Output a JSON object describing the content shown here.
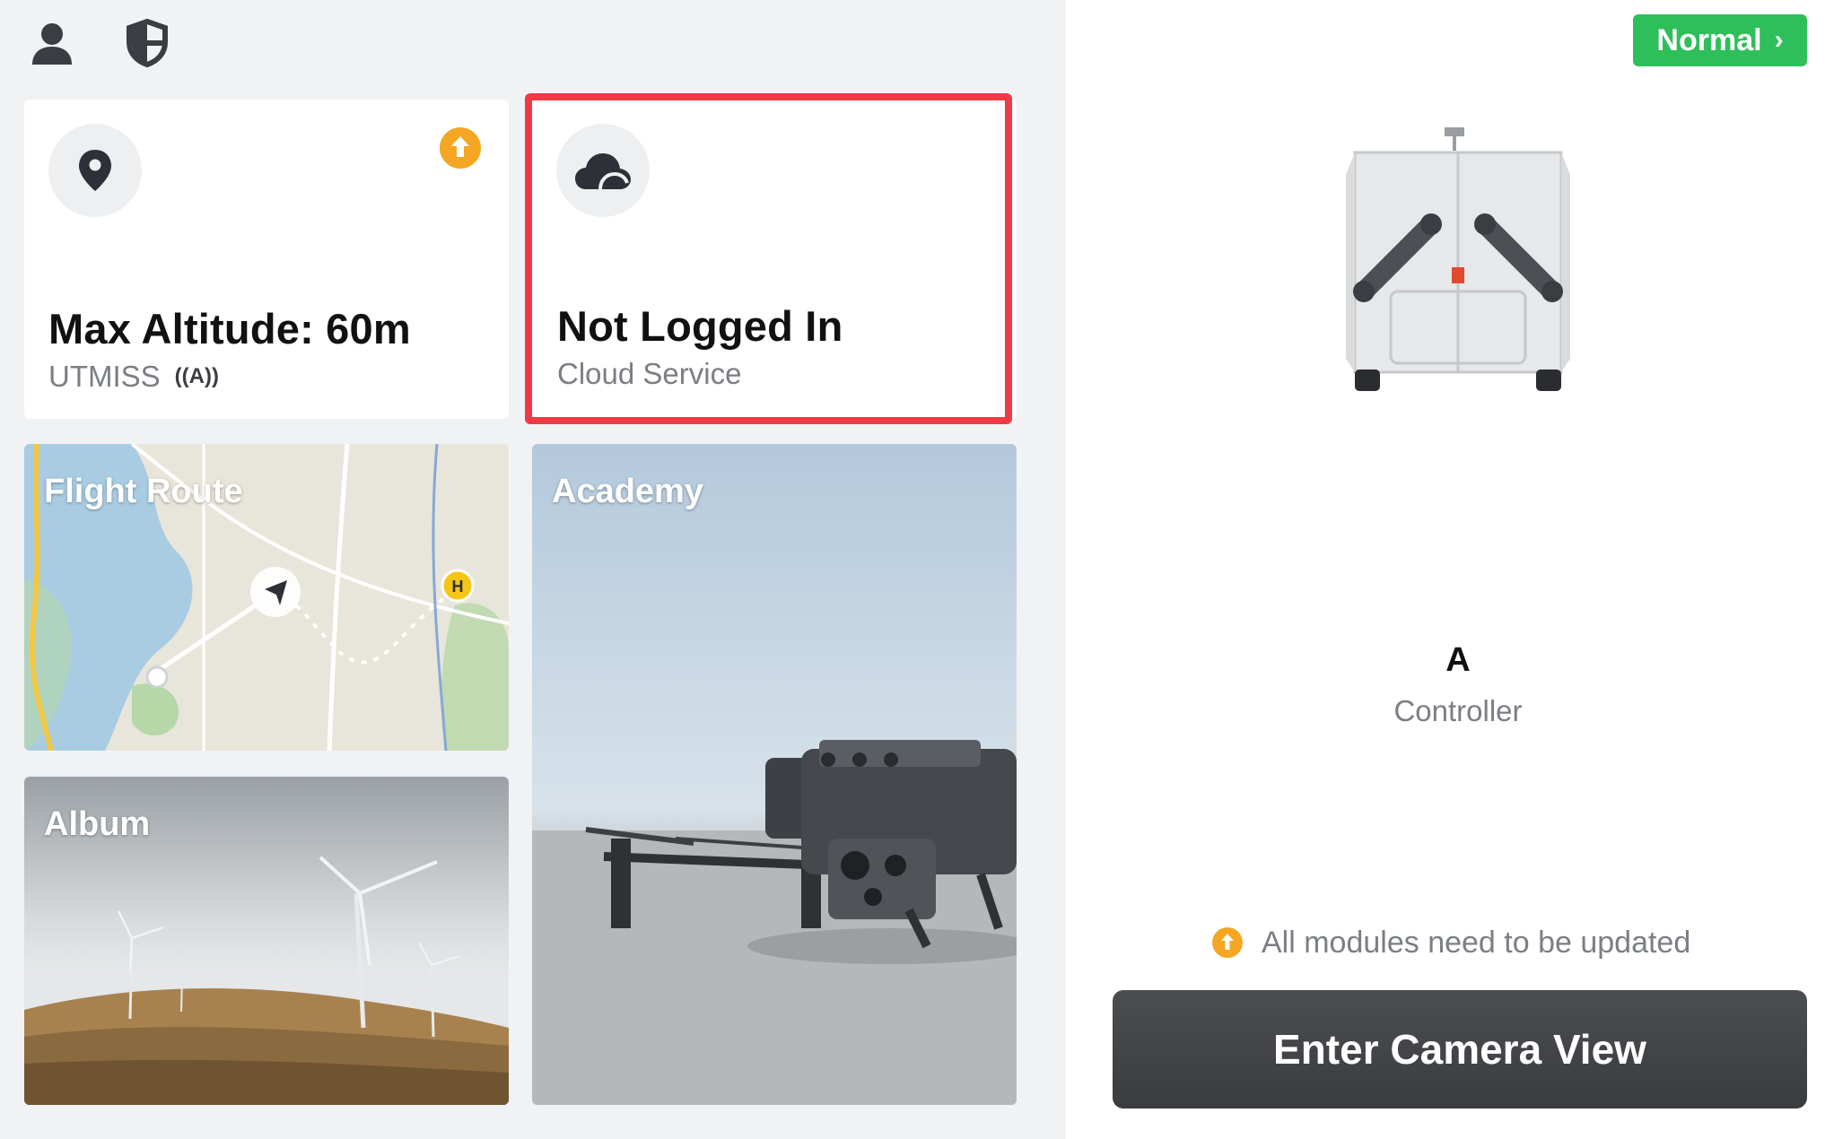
{
  "header": {
    "user_icon": "user-icon",
    "shield_icon": "shield-icon"
  },
  "altitude_card": {
    "title": "Max Altitude: 60m",
    "subtitle": "UTMISS",
    "signal_glyph": "((A))",
    "badge_icon": "upload-arrow-icon",
    "icon": "location-pin-icon"
  },
  "cloud_card": {
    "title": "Not Logged In",
    "subtitle": "Cloud Service",
    "icon": "cloud-icon"
  },
  "flight_route_tile": {
    "label": "Flight Route",
    "home_marker": "H"
  },
  "academy_tile": {
    "label": "Academy"
  },
  "album_tile": {
    "label": "Album"
  },
  "status": {
    "label": "Normal",
    "color": "#2fbf5a"
  },
  "device": {
    "name": "A",
    "role": "Controller"
  },
  "update_notice": {
    "text": "All modules need to be updated",
    "icon": "upload-arrow-icon",
    "color": "#f5a623"
  },
  "camera_button": {
    "label": "Enter Camera View"
  },
  "colors": {
    "highlight": "#ef3a45",
    "accent_orange": "#f5a623"
  }
}
